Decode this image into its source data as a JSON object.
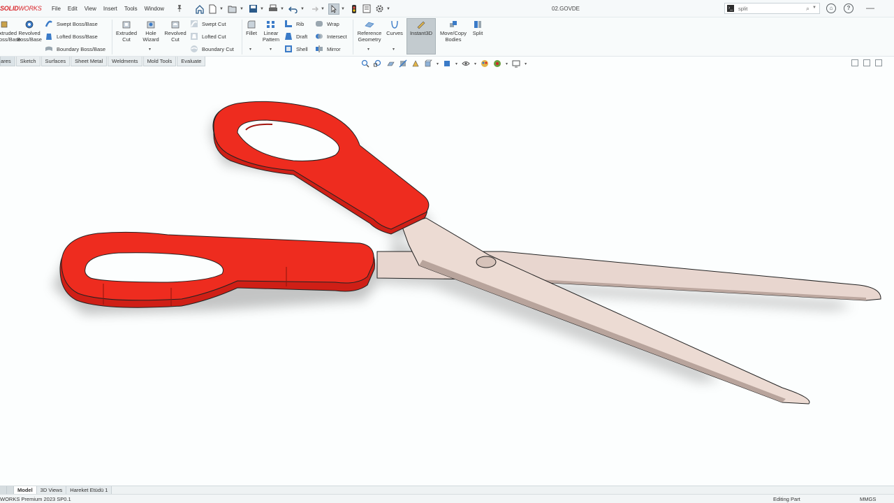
{
  "app": {
    "brand_bold": "SOLID",
    "brand_thin": "WORKS",
    "document_title": "02.GOVDE"
  },
  "menu": [
    "File",
    "Edit",
    "View",
    "Insert",
    "Tools",
    "Window"
  ],
  "search": {
    "value": "split"
  },
  "ribbon": {
    "features": {
      "extruded_boss": "Extruded\nBoss/Base",
      "revolved_boss": "Revolved\nBoss/Base",
      "swept_boss": "Swept Boss/Base",
      "lofted_boss": "Lofted Boss/Base",
      "boundary_boss": "Boundary Boss/Base",
      "extruded_cut": "Extruded\nCut",
      "hole_wizard": "Hole\nWizard",
      "revolved_cut": "Revolved\nCut",
      "swept_cut": "Swept Cut",
      "lofted_cut": "Lofted Cut",
      "boundary_cut": "Boundary Cut",
      "fillet": "Fillet",
      "linear_pattern": "Linear\nPattern",
      "rib": "Rib",
      "draft": "Draft",
      "shell": "Shell",
      "wrap": "Wrap",
      "intersect": "Intersect",
      "mirror": "Mirror",
      "reference_geometry": "Reference\nGeometry",
      "curves": "Curves",
      "instant3d": "Instant3D",
      "move_copy_bodies": "Move/Copy\nBodies",
      "split": "Split"
    }
  },
  "tabs": [
    "ares",
    "Sketch",
    "Surfaces",
    "Sheet Metal",
    "Weldments",
    "Mold Tools",
    "Evaluate"
  ],
  "bottom_tabs": [
    "Model",
    "3D Views",
    "Hareket Etüdü 1"
  ],
  "status": {
    "left": "WORKS Premium 2023 SP0.1",
    "editing": "Editing Part",
    "units": "MMGS"
  },
  "colors": {
    "handle_red": "#e8281e",
    "blade_steel": "#ead8d0",
    "brand_red": "#d9262b",
    "viewport_bg": "#fcfefe"
  }
}
